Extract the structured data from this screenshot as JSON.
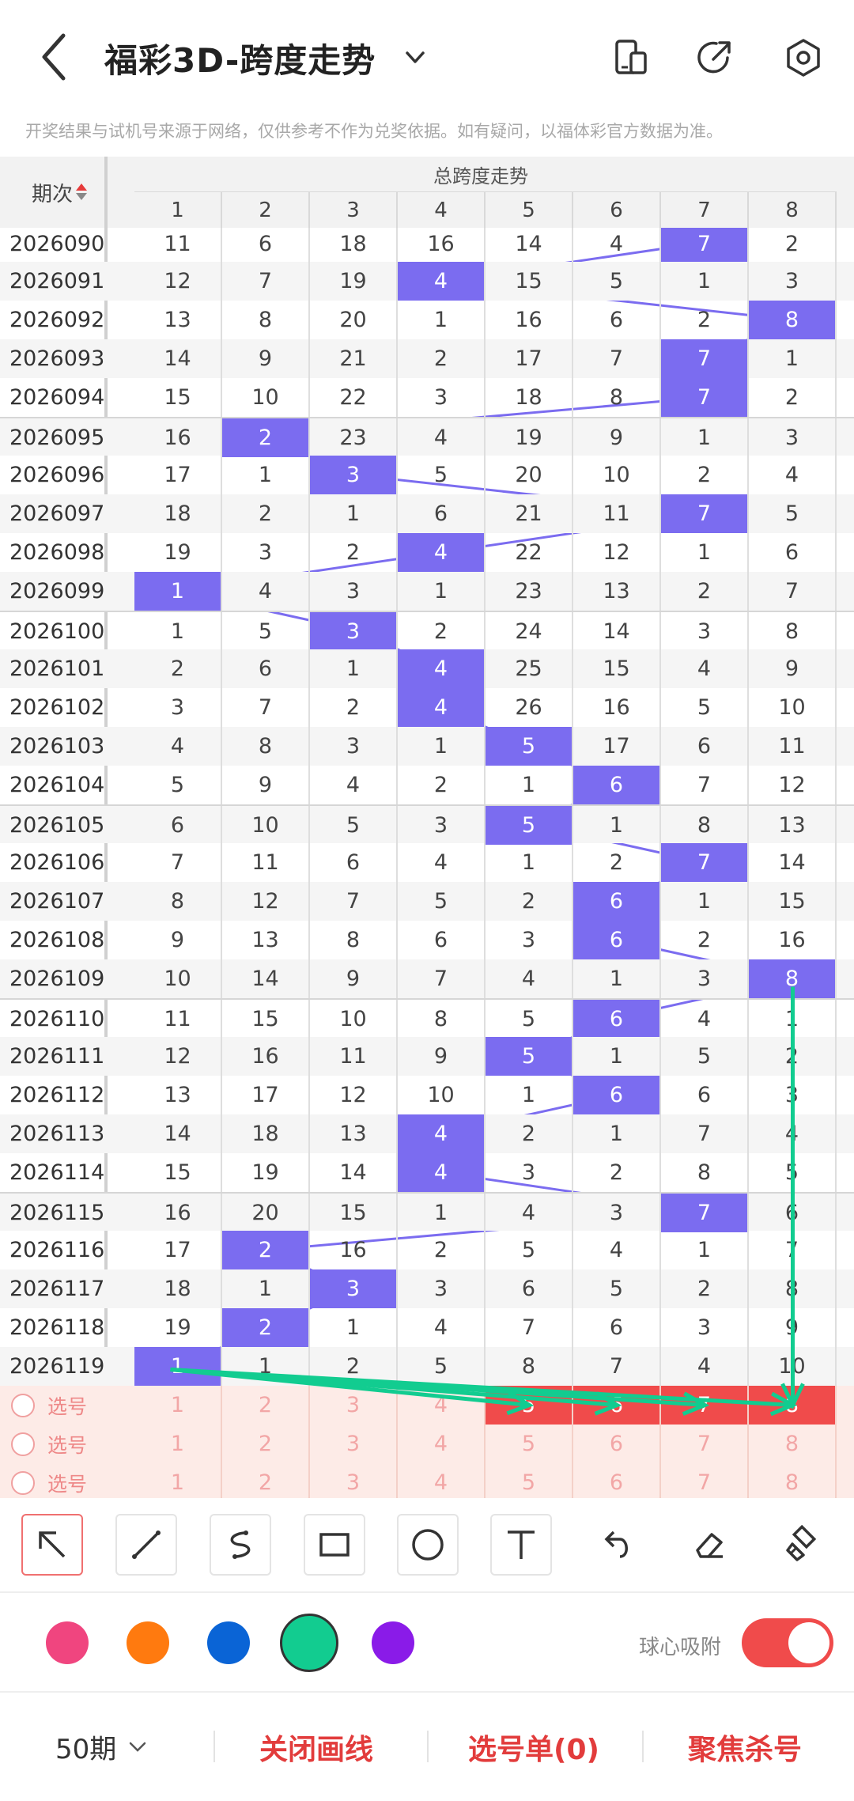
{
  "header": {
    "title": "福彩3D-跨度走势",
    "back_icon": "chevron-left-icon",
    "dropdown_icon": "chevron-down-icon",
    "icons": [
      "phone-layout-icon",
      "share-icon",
      "settings-icon"
    ]
  },
  "notice": "开奖结果与试机号来源于网络，仅供参考不作为兑奖依据。如有疑问，以福体彩官方数据为准。",
  "table": {
    "period_header": "期次",
    "group_header": "总跨度走势",
    "columns": [
      "1",
      "2",
      "3",
      "4",
      "5",
      "6",
      "7",
      "8"
    ],
    "rows": [
      {
        "p": "2026090",
        "hit": 7,
        "v": [
          "11",
          "6",
          "18",
          "16",
          "14",
          "4",
          "7",
          "2"
        ]
      },
      {
        "p": "2026091",
        "hit": 4,
        "v": [
          "12",
          "7",
          "19",
          "4",
          "15",
          "5",
          "1",
          "3"
        ]
      },
      {
        "p": "2026092",
        "hit": 8,
        "v": [
          "13",
          "8",
          "20",
          "1",
          "16",
          "6",
          "2",
          "8"
        ]
      },
      {
        "p": "2026093",
        "hit": 7,
        "v": [
          "14",
          "9",
          "21",
          "2",
          "17",
          "7",
          "7",
          "1"
        ]
      },
      {
        "p": "2026094",
        "hit": 7,
        "v": [
          "15",
          "10",
          "22",
          "3",
          "18",
          "8",
          "7",
          "2"
        ]
      },
      {
        "p": "2026095",
        "hit": 2,
        "v": [
          "16",
          "2",
          "23",
          "4",
          "19",
          "9",
          "1",
          "3"
        ]
      },
      {
        "p": "2026096",
        "hit": 3,
        "v": [
          "17",
          "1",
          "3",
          "5",
          "20",
          "10",
          "2",
          "4"
        ]
      },
      {
        "p": "2026097",
        "hit": 7,
        "v": [
          "18",
          "2",
          "1",
          "6",
          "21",
          "11",
          "7",
          "5"
        ]
      },
      {
        "p": "2026098",
        "hit": 4,
        "v": [
          "19",
          "3",
          "2",
          "4",
          "22",
          "12",
          "1",
          "6"
        ]
      },
      {
        "p": "2026099",
        "hit": 1,
        "v": [
          "1",
          "4",
          "3",
          "1",
          "23",
          "13",
          "2",
          "7"
        ]
      },
      {
        "p": "2026100",
        "hit": 3,
        "v": [
          "1",
          "5",
          "3",
          "2",
          "24",
          "14",
          "3",
          "8"
        ]
      },
      {
        "p": "2026101",
        "hit": 4,
        "v": [
          "2",
          "6",
          "1",
          "4",
          "25",
          "15",
          "4",
          "9"
        ]
      },
      {
        "p": "2026102",
        "hit": 4,
        "v": [
          "3",
          "7",
          "2",
          "4",
          "26",
          "16",
          "5",
          "10"
        ]
      },
      {
        "p": "2026103",
        "hit": 5,
        "v": [
          "4",
          "8",
          "3",
          "1",
          "5",
          "17",
          "6",
          "11"
        ]
      },
      {
        "p": "2026104",
        "hit": 6,
        "v": [
          "5",
          "9",
          "4",
          "2",
          "1",
          "6",
          "7",
          "12"
        ]
      },
      {
        "p": "2026105",
        "hit": 5,
        "v": [
          "6",
          "10",
          "5",
          "3",
          "5",
          "1",
          "8",
          "13"
        ]
      },
      {
        "p": "2026106",
        "hit": 7,
        "v": [
          "7",
          "11",
          "6",
          "4",
          "1",
          "2",
          "7",
          "14"
        ]
      },
      {
        "p": "2026107",
        "hit": 6,
        "v": [
          "8",
          "12",
          "7",
          "5",
          "2",
          "6",
          "1",
          "15"
        ]
      },
      {
        "p": "2026108",
        "hit": 6,
        "v": [
          "9",
          "13",
          "8",
          "6",
          "3",
          "6",
          "2",
          "16"
        ]
      },
      {
        "p": "2026109",
        "hit": 8,
        "v": [
          "10",
          "14",
          "9",
          "7",
          "4",
          "1",
          "3",
          "8"
        ]
      },
      {
        "p": "2026110",
        "hit": 6,
        "v": [
          "11",
          "15",
          "10",
          "8",
          "5",
          "6",
          "4",
          "1"
        ]
      },
      {
        "p": "2026111",
        "hit": 5,
        "v": [
          "12",
          "16",
          "11",
          "9",
          "5",
          "1",
          "5",
          "2"
        ]
      },
      {
        "p": "2026112",
        "hit": 6,
        "v": [
          "13",
          "17",
          "12",
          "10",
          "1",
          "6",
          "6",
          "3"
        ]
      },
      {
        "p": "2026113",
        "hit": 4,
        "v": [
          "14",
          "18",
          "13",
          "4",
          "2",
          "1",
          "7",
          "4"
        ]
      },
      {
        "p": "2026114",
        "hit": 4,
        "v": [
          "15",
          "19",
          "14",
          "4",
          "3",
          "2",
          "8",
          "5"
        ]
      },
      {
        "p": "2026115",
        "hit": 7,
        "v": [
          "16",
          "20",
          "15",
          "1",
          "4",
          "3",
          "7",
          "6"
        ]
      },
      {
        "p": "2026116",
        "hit": 2,
        "v": [
          "17",
          "2",
          "16",
          "2",
          "5",
          "4",
          "1",
          "7"
        ]
      },
      {
        "p": "2026117",
        "hit": 3,
        "v": [
          "18",
          "1",
          "3",
          "3",
          "6",
          "5",
          "2",
          "8"
        ]
      },
      {
        "p": "2026118",
        "hit": 2,
        "v": [
          "19",
          "2",
          "1",
          "4",
          "7",
          "6",
          "3",
          "9"
        ]
      },
      {
        "p": "2026119",
        "hit": 1,
        "v": [
          "1",
          "1",
          "2",
          "5",
          "8",
          "7",
          "4",
          "10"
        ]
      }
    ],
    "pick_rows": [
      {
        "label": "选号",
        "v": [
          "1",
          "2",
          "3",
          "4",
          "5",
          "6",
          "7",
          "8"
        ],
        "selected": [
          5,
          6,
          7,
          8
        ]
      },
      {
        "label": "选号",
        "v": [
          "1",
          "2",
          "3",
          "4",
          "5",
          "6",
          "7",
          "8"
        ],
        "selected": []
      },
      {
        "label": "选号",
        "v": [
          "1",
          "2",
          "3",
          "4",
          "5",
          "6",
          "7",
          "8"
        ],
        "selected": []
      }
    ]
  },
  "toolbar": {
    "tools": [
      "arrow-tool-icon",
      "line-tool-icon",
      "curve-tool-icon",
      "rectangle-tool-icon",
      "circle-tool-icon",
      "text-tool-icon",
      "undo-icon",
      "eraser-icon",
      "clear-brush-icon"
    ],
    "active_tool": "arrow-tool-icon"
  },
  "palette": {
    "colors": [
      "#f0457f",
      "#ff7a0f",
      "#0a64d6",
      "#12cc90",
      "#8a1be8"
    ],
    "selected": "#12cc90",
    "snap_label": "球心吸附",
    "snap_on": true
  },
  "bottom_bar": {
    "period": "50期",
    "close_lines": "关闭画线",
    "pick_list": "选号单(0)",
    "focus_kill": "聚焦杀号"
  }
}
